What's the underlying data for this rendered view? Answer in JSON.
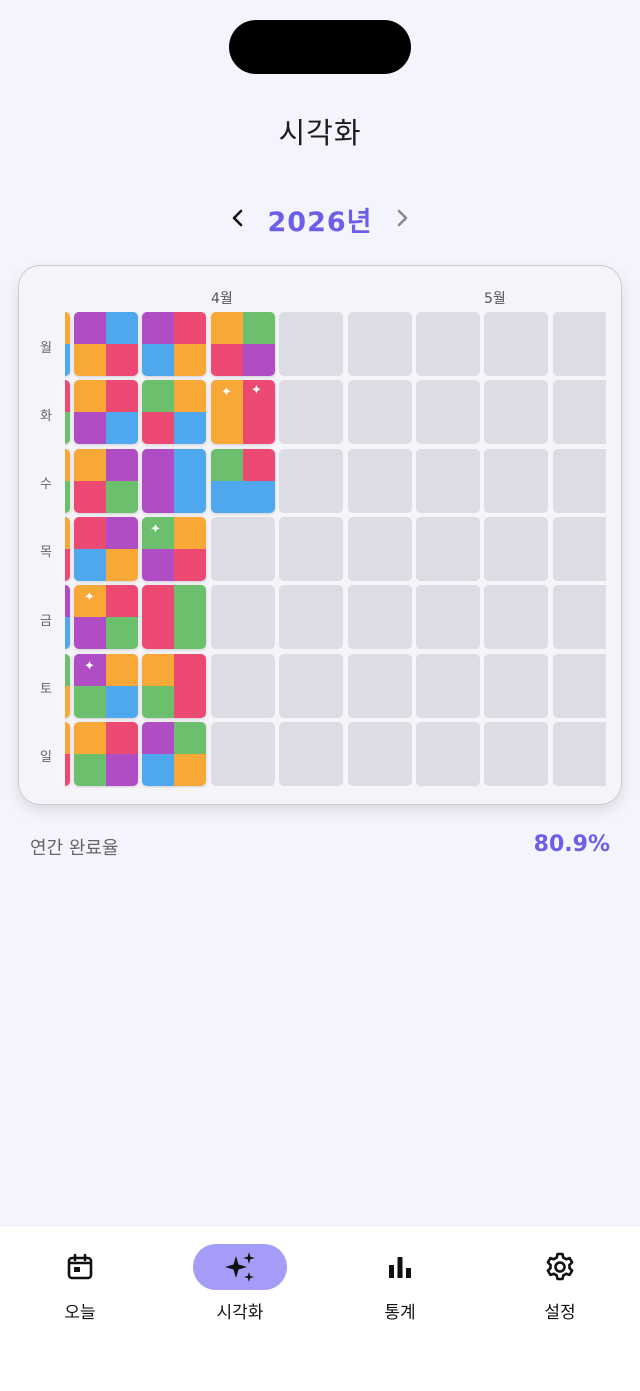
{
  "header": {
    "title": "시각화"
  },
  "year_nav": {
    "year": "2026년",
    "prev_icon": "chevron-left-icon",
    "next_icon": "chevron-right-icon"
  },
  "calendar": {
    "months": [
      "4월",
      "5월"
    ],
    "weekdays": [
      "월",
      "화",
      "수",
      "목",
      "금",
      "토",
      "일"
    ]
  },
  "summary": {
    "label": "연간 완료율",
    "value": "80.9%"
  },
  "tabs": [
    {
      "label": "오늘",
      "icon": "calendar-icon",
      "active": false
    },
    {
      "label": "시각화",
      "icon": "sparkles-icon",
      "active": true
    },
    {
      "label": "통계",
      "icon": "bar-chart-icon",
      "active": false
    },
    {
      "label": "설정",
      "icon": "gear-icon",
      "active": false
    }
  ],
  "colors": {
    "accent": "#6b5ee8",
    "active_tab_bg": "#a49cf6",
    "empty_cell": "#dcdce4",
    "red": "#ec4a72",
    "orange": "#f8a837",
    "purple": "#b04cc4",
    "blue": "#4fa8ee",
    "green": "#6cbf6c"
  }
}
